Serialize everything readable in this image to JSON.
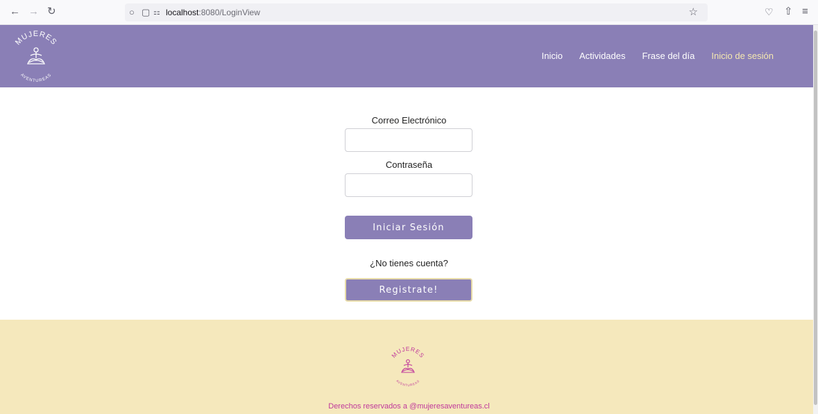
{
  "browser": {
    "url_host": "localhost",
    "url_path": ":8080/LoginView"
  },
  "header": {
    "logo_top_text": "MUJERES",
    "logo_bottom_text": "AVENTUREAS",
    "nav": [
      "Inicio",
      "Actividades",
      "Frase del día",
      "Inicio de sesión"
    ],
    "active_nav": "Inicio de sesión"
  },
  "form": {
    "email_label": "Correo Electrónico",
    "email_value": "",
    "password_label": "Contraseña",
    "password_value": "",
    "login_button": "Iniciar Sesión",
    "no_account_text": "¿No tienes cuenta?",
    "register_button": "Registrate!"
  },
  "footer": {
    "logo_top_text": "MUJERES",
    "logo_bottom_text": "AVENTUREAS",
    "copyright": "Derechos reservados a @mujeresaventureas.cl"
  },
  "colors": {
    "brand_purple": "#8a7fb6",
    "footer_bg": "#f5e8bc",
    "footer_text": "#c0399b",
    "active_nav": "#f5e8b0"
  }
}
